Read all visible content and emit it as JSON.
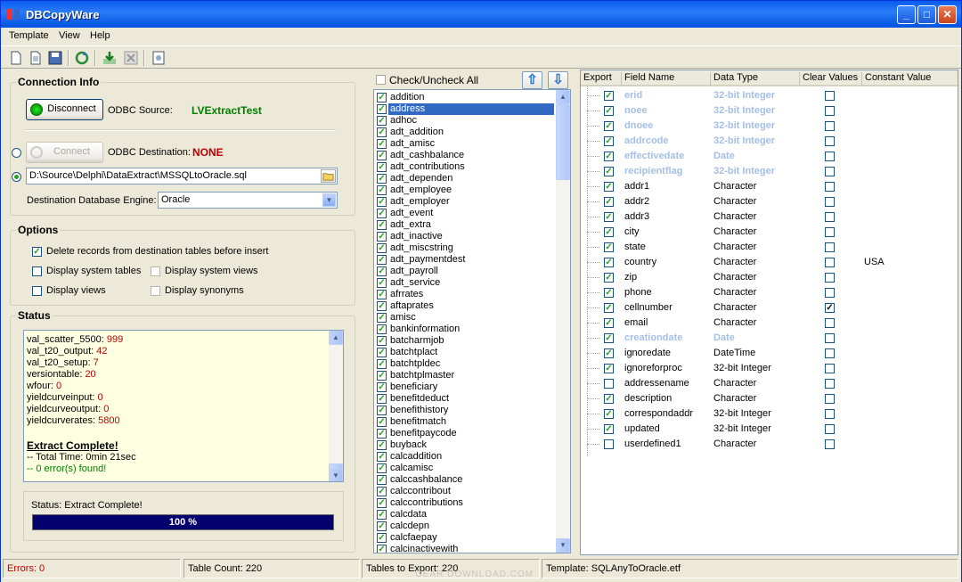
{
  "window": {
    "title": "DBCopyWare"
  },
  "menu": [
    "Template",
    "View",
    "Help"
  ],
  "connection": {
    "group_label": "Connection Info",
    "disconnect_label": "Disconnect",
    "odbc_source_label": "ODBC Source:",
    "odbc_source_value": "LVExtractTest",
    "connect_label": "Connect",
    "odbc_dest_label": "ODBC Destination:",
    "odbc_dest_value": "NONE",
    "file_path": "D:\\Source\\Delphi\\DataExtract\\MSSQLtoOracle.sql",
    "engine_label": "Destination Database Engine:",
    "engine_value": "Oracle"
  },
  "options": {
    "group_label": "Options",
    "delete_records": "Delete records from destination tables before insert",
    "display_system_tables": "Display system tables",
    "display_system_views": "Display system views",
    "display_views": "Display views",
    "display_synonyms": "Display synonyms"
  },
  "status": {
    "group_label": "Status",
    "log": [
      {
        "name": "val_scatter_5500:",
        "count": "999"
      },
      {
        "name": "val_t20_output:",
        "count": "42"
      },
      {
        "name": "val_t20_setup:",
        "count": "7"
      },
      {
        "name": "versiontable:",
        "count": "20"
      },
      {
        "name": "wfour:",
        "count": "0"
      },
      {
        "name": "yieldcurveinput:",
        "count": "0"
      },
      {
        "name": "yieldcurveoutput:",
        "count": "0"
      },
      {
        "name": "yieldcurverates:",
        "count": "5800"
      }
    ],
    "extract_complete": "Extract Complete!",
    "total_time": "-- Total Time: 0min 21sec",
    "errors_found": "-- 0 error(s) found!",
    "status_line": "Status: Extract Complete!",
    "progress_label": "100 %",
    "progress_value": 1.0
  },
  "tables": {
    "check_all_label": "Check/Uncheck All",
    "selected": "address",
    "items": [
      "addition",
      "address",
      "adhoc",
      "adt_addition",
      "adt_amisc",
      "adt_cashbalance",
      "adt_contributions",
      "adt_dependen",
      "adt_employee",
      "adt_employer",
      "adt_event",
      "adt_extra",
      "adt_inactive",
      "adt_miscstring",
      "adt_paymentdest",
      "adt_payroll",
      "adt_service",
      "afrrates",
      "aftaprates",
      "amisc",
      "bankinformation",
      "batcharmjob",
      "batchtplact",
      "batchtpldec",
      "batchtplmaster",
      "beneficiary",
      "benefitdeduct",
      "benefithistory",
      "benefitmatch",
      "benefitpaycode",
      "buyback",
      "calcaddition",
      "calcamisc",
      "calccashbalance",
      "calccontribout",
      "calccontributions",
      "calcdata",
      "calcdepn",
      "calcfaepay",
      "calcinactivewith"
    ]
  },
  "fields": {
    "headers": [
      "Export",
      "Field Name",
      "Data Type",
      "Clear Values",
      "Constant Value"
    ],
    "rows": [
      {
        "name": "erid",
        "type": "32-bit Integer",
        "export": true,
        "clear": false,
        "constant": "",
        "key": true
      },
      {
        "name": "noee",
        "type": "32-bit Integer",
        "export": true,
        "clear": false,
        "constant": "",
        "key": true
      },
      {
        "name": "dnoee",
        "type": "32-bit Integer",
        "export": true,
        "clear": false,
        "constant": "",
        "key": true
      },
      {
        "name": "addrcode",
        "type": "32-bit Integer",
        "export": true,
        "clear": false,
        "constant": "",
        "key": true
      },
      {
        "name": "effectivedate",
        "type": "Date",
        "export": true,
        "clear": false,
        "constant": "",
        "key": true
      },
      {
        "name": "recipientflag",
        "type": "32-bit Integer",
        "export": true,
        "clear": false,
        "constant": "",
        "key": true
      },
      {
        "name": "addr1",
        "type": "Character",
        "export": true,
        "clear": false,
        "constant": "",
        "key": false
      },
      {
        "name": "addr2",
        "type": "Character",
        "export": true,
        "clear": false,
        "constant": "",
        "key": false
      },
      {
        "name": "addr3",
        "type": "Character",
        "export": true,
        "clear": false,
        "constant": "",
        "key": false
      },
      {
        "name": "city",
        "type": "Character",
        "export": true,
        "clear": false,
        "constant": "",
        "key": false
      },
      {
        "name": "state",
        "type": "Character",
        "export": true,
        "clear": false,
        "constant": "",
        "key": false
      },
      {
        "name": "country",
        "type": "Character",
        "export": true,
        "clear": false,
        "constant": "USA",
        "key": false
      },
      {
        "name": "zip",
        "type": "Character",
        "export": true,
        "clear": false,
        "constant": "",
        "key": false
      },
      {
        "name": "phone",
        "type": "Character",
        "export": true,
        "clear": false,
        "constant": "",
        "key": false
      },
      {
        "name": "cellnumber",
        "type": "Character",
        "export": true,
        "clear": true,
        "constant": "",
        "key": false
      },
      {
        "name": "email",
        "type": "Character",
        "export": true,
        "clear": false,
        "constant": "",
        "key": false
      },
      {
        "name": "creationdate",
        "type": "Date",
        "export": true,
        "clear": false,
        "constant": "",
        "key": true
      },
      {
        "name": "ignoredate",
        "type": "DateTime",
        "export": true,
        "clear": false,
        "constant": "",
        "key": false
      },
      {
        "name": "ignoreforproc",
        "type": "32-bit Integer",
        "export": true,
        "clear": false,
        "constant": "",
        "key": false
      },
      {
        "name": "addressename",
        "type": "Character",
        "export": false,
        "clear": false,
        "constant": "",
        "key": false
      },
      {
        "name": "description",
        "type": "Character",
        "export": true,
        "clear": false,
        "constant": "",
        "key": false
      },
      {
        "name": "correspondaddr",
        "type": "32-bit Integer",
        "export": true,
        "clear": false,
        "constant": "",
        "key": false
      },
      {
        "name": "updated",
        "type": "32-bit Integer",
        "export": true,
        "clear": false,
        "constant": "",
        "key": false
      },
      {
        "name": "userdefined1",
        "type": "Character",
        "export": false,
        "clear": false,
        "constant": "",
        "key": false
      }
    ]
  },
  "statusbar": {
    "errors": "Errors: 0",
    "table_count": "Table Count: 220",
    "tables_to_export": "Tables to Export: 220",
    "template": "Template: SQLAnyToOracle.etf"
  },
  "watermark": "GEAR DOWNLOAD.COM",
  "colors": {
    "accent": "#316AC5",
    "key_field": "#A4BFE3",
    "progress": "#04006E",
    "source_value": "#008000",
    "dest_value": "#C00000"
  },
  "icons": [
    "new-icon",
    "open-icon",
    "save-icon",
    "refresh-icon",
    "export-icon",
    "cancel-icon",
    "properties-icon"
  ]
}
